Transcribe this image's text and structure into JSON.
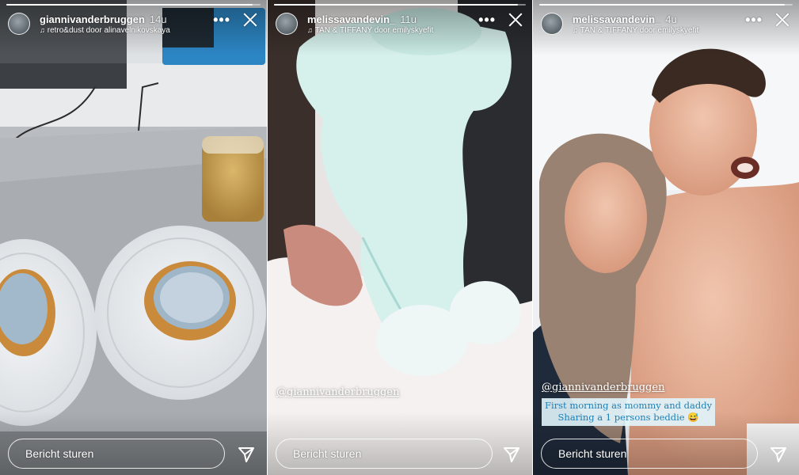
{
  "stories": [
    {
      "username": "giannivanderbruggen",
      "time": "14u",
      "music": "retro&dust door alinavelnikovskaya",
      "progress": 0.97,
      "message_placeholder": "Bericht sturen"
    },
    {
      "username": "melissavandevin_",
      "time": "11u",
      "music": "TAN & TIFFANY door emilyskyefit",
      "progress": 0.97,
      "mention": "@giannivanderbruggen",
      "message_placeholder": "Bericht sturen"
    },
    {
      "username": "melissavandevin_",
      "time": "4u",
      "music": "TAN & TIFFANY door emilyskyefit",
      "progress": 0.97,
      "mention": "@giannivanderbruggen",
      "caption_line1": "First morning as mommy and daddy",
      "caption_line2": "Sharing a 1 persons beddie 😅",
      "message_placeholder": "Bericht sturen"
    }
  ],
  "icons": {
    "more": "more-options-icon",
    "close": "close-icon",
    "send": "send-icon",
    "music": "music-note-icon"
  },
  "colors": {
    "ui_text": "#ffffff",
    "caption_text": "#1e7fb5",
    "caption_bg": "#e1f5fc"
  }
}
